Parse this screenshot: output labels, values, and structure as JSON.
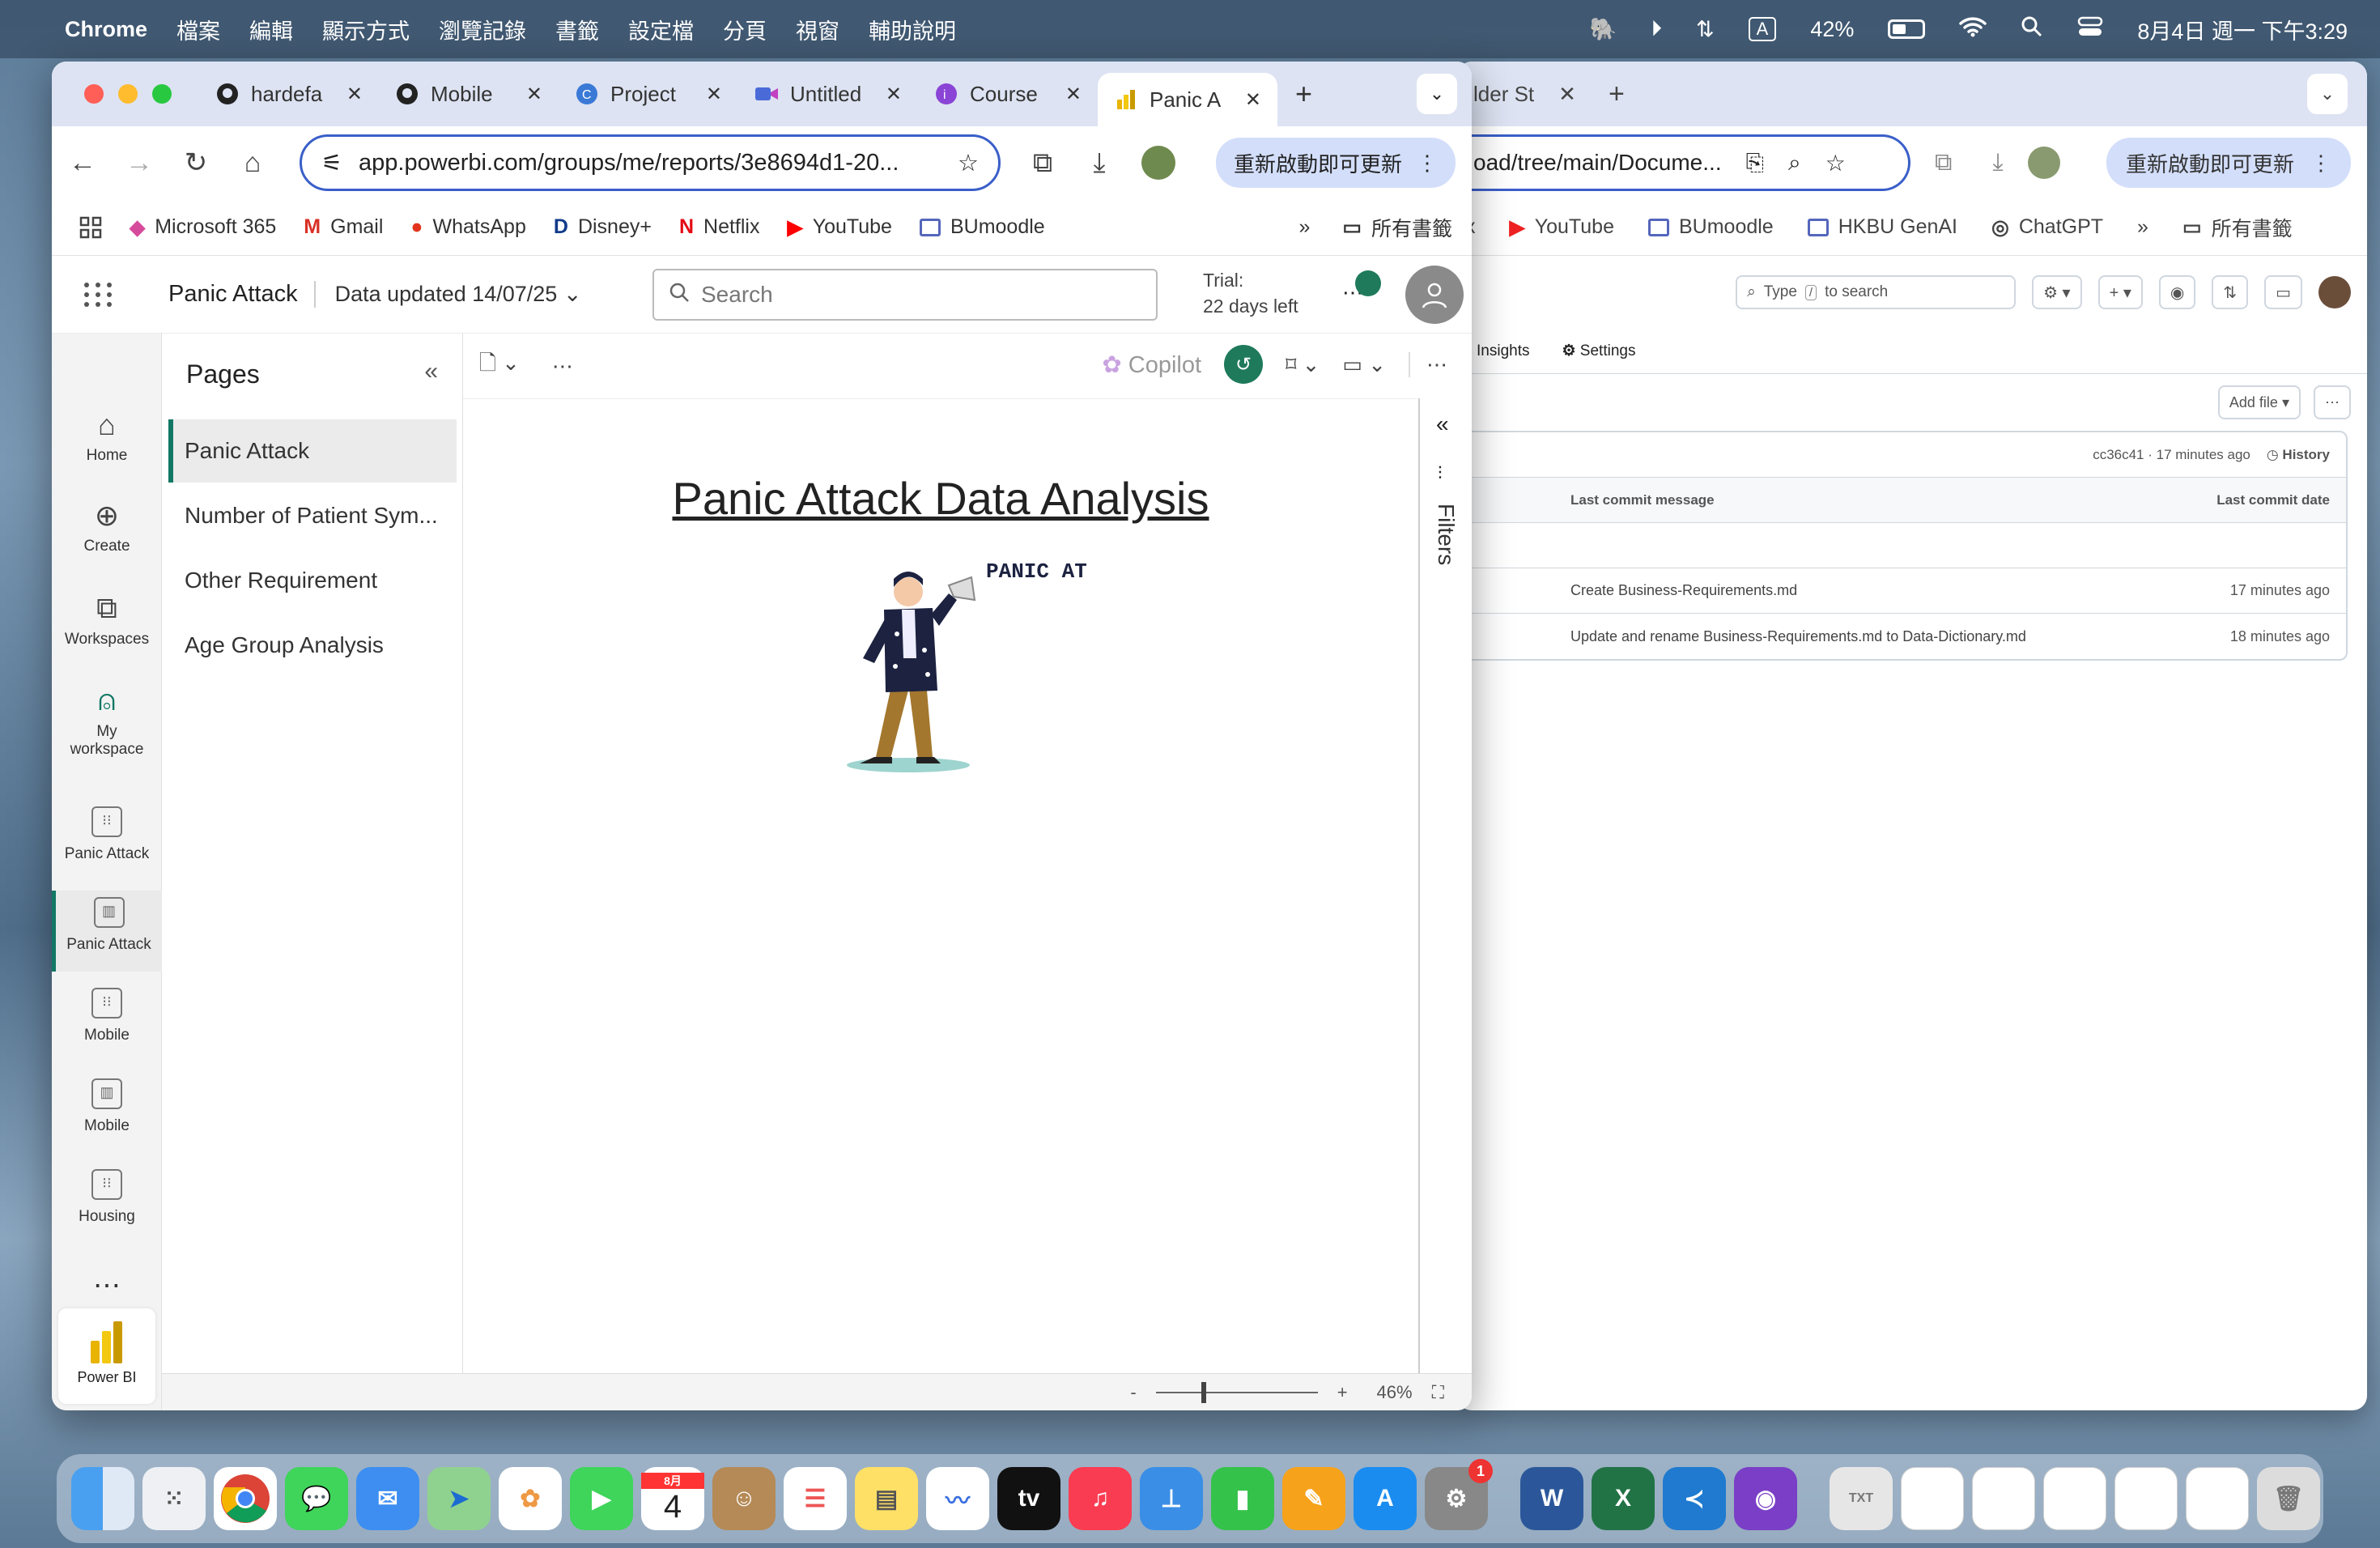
{
  "menubar": {
    "app": "Chrome",
    "items": [
      "檔案",
      "編輯",
      "顯示方式",
      "瀏覽記錄",
      "書籤",
      "設定檔",
      "分頁",
      "視窗",
      "輔助說明"
    ],
    "battery": "42%",
    "datetime": "8月4日 週一 下午3:29",
    "input_indicator": "A"
  },
  "tabs": [
    {
      "title": "hardefa",
      "icon": "github-icon"
    },
    {
      "title": "Mobile",
      "icon": "github-icon"
    },
    {
      "title": "Project",
      "icon": "canva-icon"
    },
    {
      "title": "Untitled",
      "icon": "video-icon"
    },
    {
      "title": "Course",
      "icon": "course-icon"
    },
    {
      "title": "Panic A",
      "icon": "powerbi-icon",
      "active": true
    }
  ],
  "address": {
    "url": "app.powerbi.com/groups/me/reports/3e8694d1-20...",
    "update_label": "重新啟動即可更新"
  },
  "bookmarks": [
    "Microsoft 365",
    "Gmail",
    "WhatsApp",
    "Disney+",
    "Netflix",
    "YouTube",
    "BUmoodle"
  ],
  "bookmarks_folder": "所有書籤",
  "pbi": {
    "report_name": "Panic Attack",
    "data_updated": "Data updated 14/07/25",
    "search_placeholder": "Search",
    "trial_line1": "Trial:",
    "trial_line2": "22 days left",
    "copilot": "Copilot",
    "nav": [
      {
        "label": "Home",
        "icon": "home-icon"
      },
      {
        "label": "Create",
        "icon": "create-icon"
      },
      {
        "label": "Workspaces",
        "icon": "workspaces-icon"
      },
      {
        "label": "My workspace",
        "icon": "my-workspace-icon"
      },
      {
        "label": "Panic Attack",
        "icon": "report-icon"
      },
      {
        "label": "Panic Attack",
        "icon": "chart-report-icon",
        "selected": true
      },
      {
        "label": "Mobile",
        "icon": "report-icon"
      },
      {
        "label": "Mobile",
        "icon": "chart-report-icon"
      },
      {
        "label": "Housing",
        "icon": "report-icon"
      }
    ],
    "logo_label": "Power BI",
    "pages_title": "Pages",
    "pages": [
      "Panic Attack",
      "Number of Patient Sym...",
      "Other Requirement",
      "Age Group Analysis"
    ],
    "report_title": "Panic Attack Data Analysis",
    "illustration_text": "PANIC ATTACK",
    "filters_label": "Filters",
    "zoom_minus": "-",
    "zoom_plus": "+",
    "zoom": "46%"
  },
  "bg_window": {
    "tab_title": "lder St",
    "url": "oad/tree/main/Docume...",
    "update_label": "重新啟動即可更新",
    "bookmarks": [
      "YouTube",
      "BUmoodle",
      "HKBU GenAI",
      "ChatGPT"
    ],
    "bookmarks_folder": "所有書籤",
    "search_placeholder_prefix": "Type",
    "search_key": "/",
    "search_placeholder_suffix": "to search",
    "nav": [
      "Insights",
      "Settings"
    ],
    "add_file": "Add file",
    "commit_info": "cc36c41 · 17 minutes ago",
    "history": "History",
    "col_message": "Last commit message",
    "col_date": "Last commit date",
    "rows": [
      {
        "message": "Create Business-Requirements.md",
        "date": "17 minutes ago"
      },
      {
        "message": "Update and rename Business-Requirements.md to Data-Dictionary.md",
        "date": "18 minutes ago"
      }
    ]
  },
  "dock": {
    "calendar_month": "8月",
    "calendar_day": "4",
    "settings_badge": "1",
    "apps": [
      "Finder",
      "Launchpad",
      "Chrome",
      "Messages",
      "Mail",
      "Maps",
      "Photos",
      "FaceTime",
      "Calendar",
      "Contacts",
      "Reminders",
      "Notes",
      "Freeform",
      "TV",
      "Music",
      "Keynote",
      "Numbers",
      "Pages",
      "App Store",
      "System Settings",
      "Word",
      "Excel",
      "VS Code",
      "GitHub Desktop"
    ]
  }
}
